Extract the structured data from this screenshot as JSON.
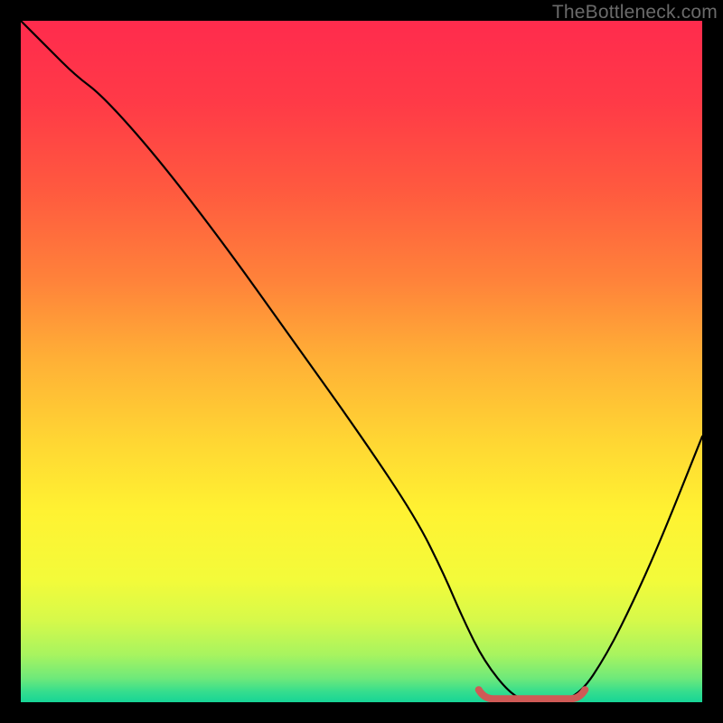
{
  "watermark": "TheBottleneck.com",
  "gradient": {
    "stops": [
      {
        "offset": 0.0,
        "color": "#ff2b4d"
      },
      {
        "offset": 0.12,
        "color": "#ff3a47"
      },
      {
        "offset": 0.25,
        "color": "#ff5a3f"
      },
      {
        "offset": 0.38,
        "color": "#ff823a"
      },
      {
        "offset": 0.5,
        "color": "#ffb136"
      },
      {
        "offset": 0.62,
        "color": "#ffd733"
      },
      {
        "offset": 0.72,
        "color": "#fff232"
      },
      {
        "offset": 0.82,
        "color": "#f3fb3a"
      },
      {
        "offset": 0.88,
        "color": "#d6f94a"
      },
      {
        "offset": 0.93,
        "color": "#a8f45f"
      },
      {
        "offset": 0.965,
        "color": "#6ee97a"
      },
      {
        "offset": 0.985,
        "color": "#34dd8e"
      },
      {
        "offset": 1.0,
        "color": "#17d596"
      }
    ]
  },
  "chart_data": {
    "type": "line",
    "title": "",
    "xlabel": "",
    "ylabel": "",
    "xlim": [
      0,
      100
    ],
    "ylim": [
      0,
      100
    ],
    "grid": false,
    "series": [
      {
        "name": "bottleneck-curve",
        "x": [
          0,
          4,
          8,
          12,
          20,
          30,
          40,
          50,
          58,
          62,
          65,
          68,
          72,
          75,
          78,
          82,
          86,
          90,
          94,
          100
        ],
        "y": [
          100,
          96,
          92,
          89,
          80,
          67,
          53,
          39,
          27,
          19,
          12,
          6,
          1,
          0,
          0,
          1,
          7,
          15,
          24,
          39
        ]
      }
    ],
    "optimal_band": {
      "x_start": 68,
      "x_end": 82,
      "y": 0.5
    }
  },
  "colors": {
    "curve": "#000000",
    "band": "#cf5a56",
    "frame_bg": "#000000"
  }
}
